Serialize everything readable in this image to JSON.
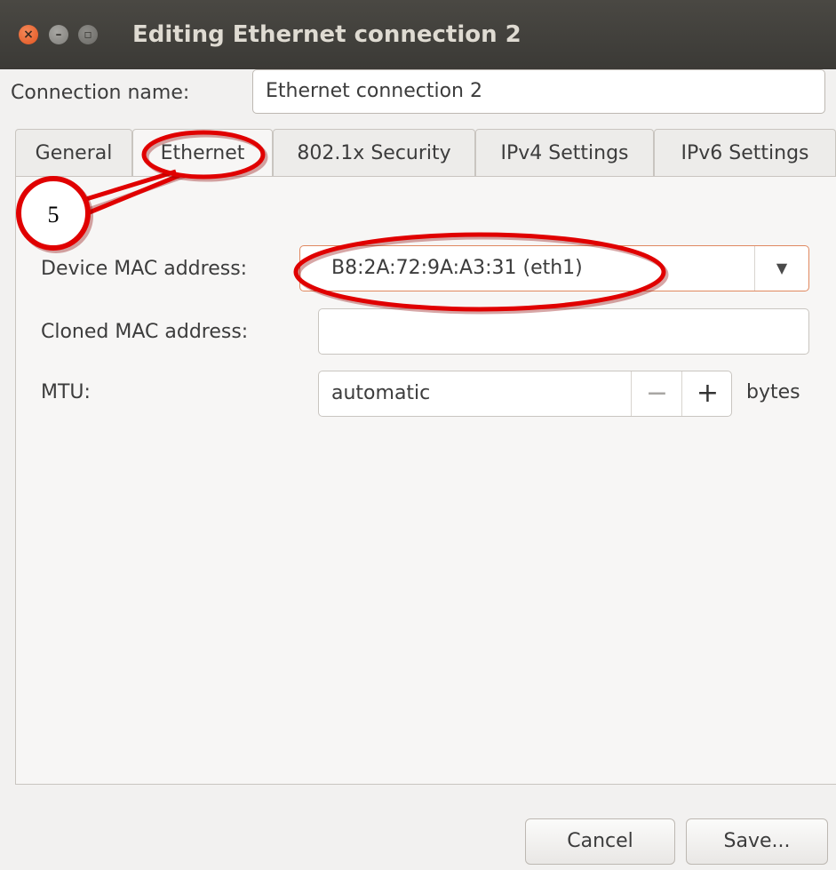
{
  "window": {
    "title": "Editing Ethernet connection 2",
    "close_glyph": "×",
    "minimize_glyph": "–",
    "maximize_glyph": "▫"
  },
  "connection": {
    "label": "Connection name:",
    "value": "Ethernet connection 2"
  },
  "tabs": [
    {
      "label": "General",
      "active": false
    },
    {
      "label": "Ethernet",
      "active": true
    },
    {
      "label": "802.1x Security",
      "active": false
    },
    {
      "label": "IPv4 Settings",
      "active": false
    },
    {
      "label": "IPv6 Settings",
      "active": false
    }
  ],
  "ethernet": {
    "device_mac_label": "Device MAC address:",
    "device_mac_value": "B8:2A:72:9A:A3:31 (eth1)",
    "dropdown_arrow": "▼",
    "cloned_mac_label": "Cloned MAC address:",
    "cloned_mac_value": "",
    "mtu_label": "MTU:",
    "mtu_value": "automatic",
    "mtu_minus": "−",
    "mtu_plus": "+",
    "mtu_unit": "bytes"
  },
  "buttons": {
    "cancel": "Cancel",
    "save": "Save..."
  },
  "annotation": {
    "number": "5",
    "color": "#e00000"
  },
  "colors": {
    "titlebar": "#3b3a36",
    "close_button": "#e0531f",
    "focus_border": "#e08860"
  }
}
